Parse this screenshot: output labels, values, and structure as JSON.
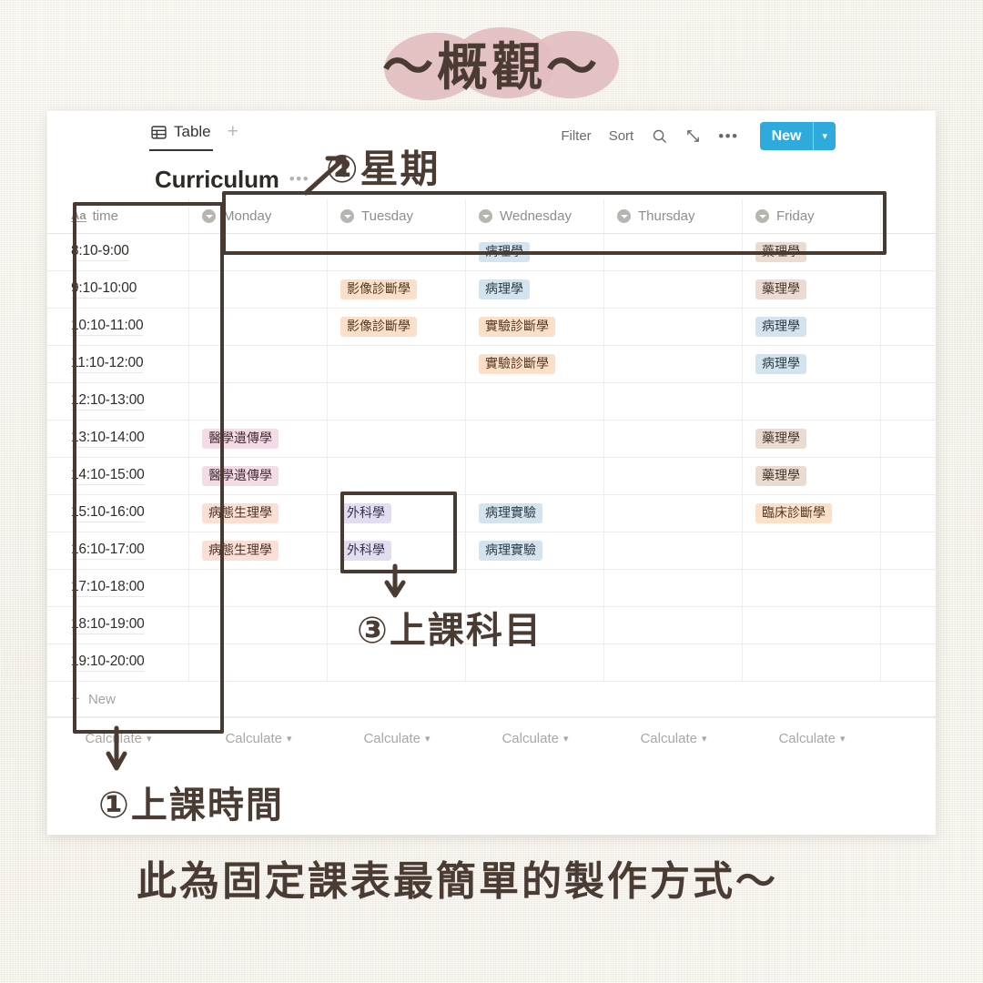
{
  "title": {
    "text": "〜概觀〜"
  },
  "colors": {
    "accent_blue": "#2eaadc",
    "ink_brown": "#4a3b33",
    "title_blob_pink": "#e2bec1",
    "paper": "#f2f0ea"
  },
  "app": {
    "view_tab": {
      "label": "Table",
      "icon": "table-grid-icon"
    },
    "add_view_label": "+",
    "toolbar": {
      "filter_label": "Filter",
      "sort_label": "Sort",
      "search_icon": "search-icon",
      "expand_icon": "expand-diagonal-icon",
      "more_icon": "ellipsis-icon",
      "new_label": "New",
      "new_dropdown_icon": "chevron-down-icon"
    },
    "database": {
      "title": "Curriculum",
      "more_icon": "ellipsis-icon"
    },
    "table": {
      "columns": [
        {
          "label": "time",
          "icon": "text-aa-icon"
        },
        {
          "label": "Monday",
          "icon": "select-circle-icon"
        },
        {
          "label": "Tuesday",
          "icon": "select-circle-icon"
        },
        {
          "label": "Wednesday",
          "icon": "select-circle-icon"
        },
        {
          "label": "Thursday",
          "icon": "select-circle-icon"
        },
        {
          "label": "Friday",
          "icon": "select-circle-icon"
        }
      ],
      "rows": [
        {
          "time": "8:10-9:00",
          "Monday": null,
          "Tuesday": null,
          "Wednesday": "病理學",
          "Thursday": null,
          "Friday": "藥理學"
        },
        {
          "time": "9:10-10:00",
          "Monday": null,
          "Tuesday": "影像診斷學",
          "Wednesday": "病理學",
          "Thursday": null,
          "Friday": "藥理學"
        },
        {
          "time": "10:10-11:00",
          "Monday": null,
          "Tuesday": "影像診斷學",
          "Wednesday": "實驗診斷學",
          "Thursday": null,
          "Friday": "病理學"
        },
        {
          "time": "11:10-12:00",
          "Monday": null,
          "Tuesday": null,
          "Wednesday": "實驗診斷學",
          "Thursday": null,
          "Friday": "病理學"
        },
        {
          "time": "12:10-13:00",
          "Monday": null,
          "Tuesday": null,
          "Wednesday": null,
          "Thursday": null,
          "Friday": null
        },
        {
          "time": "13:10-14:00",
          "Monday": "醫學遺傳學",
          "Tuesday": null,
          "Wednesday": null,
          "Thursday": null,
          "Friday": "藥理學"
        },
        {
          "time": "14:10-15:00",
          "Monday": "醫學遺傳學",
          "Tuesday": null,
          "Wednesday": null,
          "Thursday": null,
          "Friday": "藥理學"
        },
        {
          "time": "15:10-16:00",
          "Monday": "病態生理學",
          "Tuesday": "外科學",
          "Wednesday": "病理實驗",
          "Thursday": null,
          "Friday": "臨床診斷學"
        },
        {
          "time": "16:10-17:00",
          "Monday": "病態生理學",
          "Tuesday": "外科學",
          "Wednesday": "病理實驗",
          "Thursday": null,
          "Friday": null
        },
        {
          "time": "17:10-18:00",
          "Monday": null,
          "Tuesday": null,
          "Wednesday": null,
          "Thursday": null,
          "Friday": null
        },
        {
          "time": "18:10-19:00",
          "Monday": null,
          "Tuesday": null,
          "Wednesday": null,
          "Thursday": null,
          "Friday": null
        },
        {
          "time": "19:10-20:00",
          "Monday": null,
          "Tuesday": null,
          "Wednesday": null,
          "Thursday": null,
          "Friday": null
        }
      ],
      "tag_styles": {
        "病理學": "t-blue",
        "病理實驗": "t-blue",
        "影像診斷學": "t-orange",
        "實驗診斷學": "t-orange",
        "臨床診斷學": "t-orange",
        "藥理學": "t-tan",
        "醫學遺傳學": "t-pink",
        "病態生理學": "t-peach",
        "外科學": "t-purple"
      },
      "new_row_label": "New",
      "new_row_icon": "plus-icon",
      "calculate_label": "Calculate",
      "calculate_icon": "chevron-down-icon",
      "calculate_count": 6
    }
  },
  "annotations": {
    "days": "②星期",
    "subject": "③上課科目",
    "time": "①上課時間",
    "caption": "此為固定課表最簡單的製作方式〜"
  }
}
